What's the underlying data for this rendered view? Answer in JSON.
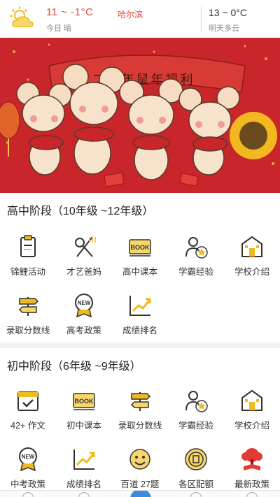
{
  "weather": {
    "today_temp": "11 ~ -1°C",
    "city": "哈尔滨",
    "today_desc": "今日 晴",
    "tomorrow_temp": "13 ~ 0°C",
    "tomorrow_desc": "明天多云",
    "icon": "sun-cloud-icon"
  },
  "banner": {
    "caption": "二零年鼠年福利"
  },
  "high_school": {
    "title": "高中阶段（10年级 ~12年级）",
    "items": [
      {
        "label": "锦鲤活动",
        "icon": "clipboard-icon"
      },
      {
        "label": "才艺爸妈",
        "icon": "utensils-icon"
      },
      {
        "label": "高中课本",
        "icon": "book-icon"
      },
      {
        "label": "学霸经验",
        "icon": "star-user-icon"
      },
      {
        "label": "学校介绍",
        "icon": "school-building-icon"
      },
      {
        "label": "录取分数线",
        "icon": "signpost-icon"
      },
      {
        "label": "高考政策",
        "icon": "new-badge-icon"
      },
      {
        "label": "成绩排名",
        "icon": "trend-chart-icon"
      }
    ]
  },
  "middle_school": {
    "title": "初中阶段（6年级 ~9年级）",
    "items": [
      {
        "label": "42+ 作文",
        "icon": "calendar-check-icon"
      },
      {
        "label": "初中课本",
        "icon": "book-icon"
      },
      {
        "label": "录取分数线",
        "icon": "signpost-icon"
      },
      {
        "label": "学霸经验",
        "icon": "star-user-icon"
      },
      {
        "label": "学校介绍",
        "icon": "school-building-icon"
      },
      {
        "label": "中考政策",
        "icon": "new-badge-icon"
      },
      {
        "label": "成绩排名",
        "icon": "trend-chart-icon"
      },
      {
        "label": "百道 27题",
        "icon": "smiley-icon"
      },
      {
        "label": "各区配额",
        "icon": "stamp-icon"
      },
      {
        "label": "最新政策",
        "icon": "tree-book-icon"
      }
    ]
  },
  "colors": {
    "accent_red": "#e5483a",
    "icon_gold": "#f0b91c",
    "icon_line": "#333333",
    "tab_active": "#3b8ce0"
  }
}
